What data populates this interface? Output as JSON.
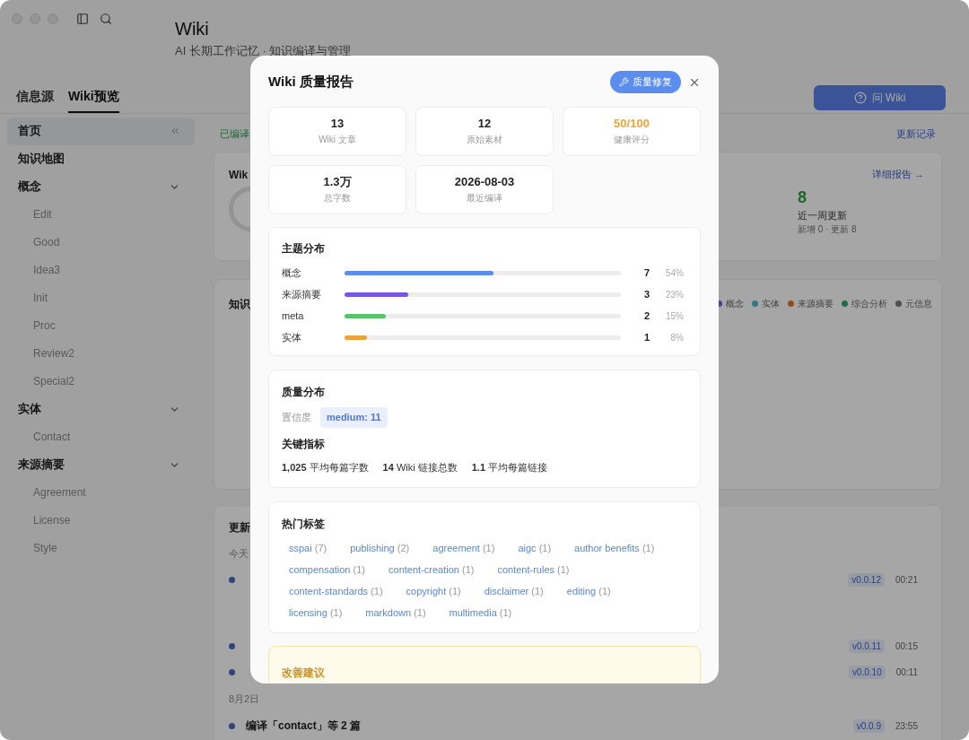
{
  "window": {
    "title": "Wiki",
    "subtitle": "AI 长期工作记忆 · 知识编译与管理"
  },
  "tabs": [
    {
      "label": "信息源",
      "selected": false
    },
    {
      "label": "Wiki预览",
      "selected": true
    }
  ],
  "ask_button": {
    "label": "问 Wiki"
  },
  "sidebar": {
    "items": [
      {
        "label": "首页",
        "selected": true
      },
      {
        "label": "知识地图",
        "selected": false
      },
      {
        "label": "概念",
        "selected": false,
        "expanded": true,
        "children": [
          {
            "label": "Edit",
            "selected": false
          },
          {
            "label": "Good",
            "selected": false
          },
          {
            "label": "Idea3",
            "selected": false
          },
          {
            "label": "Init",
            "selected": false
          },
          {
            "label": "Proc",
            "selected": false
          },
          {
            "label": "Review2",
            "selected": false
          },
          {
            "label": "Special2",
            "selected": false
          }
        ]
      },
      {
        "label": "实体",
        "selected": false,
        "expanded": true,
        "children": [
          {
            "label": "Contact",
            "selected": false
          }
        ]
      },
      {
        "label": "来源摘要",
        "selected": false,
        "expanded": true,
        "children": [
          {
            "label": "Agreement",
            "selected": false
          },
          {
            "label": "License",
            "selected": false
          },
          {
            "label": "Style",
            "selected": false
          }
        ]
      }
    ]
  },
  "main": {
    "status": "已编译",
    "history_link": "更新记录",
    "overview_card": {
      "title": "Wik",
      "detail_link": "详细报告 →",
      "stat_value": "8",
      "stat_label": "近一周更新",
      "stat_note": "新增 0 · 更新 8"
    },
    "map_card": {
      "title": "知识",
      "legend": [
        {
          "label": "概念",
          "color": "#40429d"
        },
        {
          "label": "实体",
          "color": "#337887"
        },
        {
          "label": "来源摘要",
          "color": "#934d1b"
        },
        {
          "label": "综合分析",
          "color": "#1f6b48"
        },
        {
          "label": "元信息",
          "color": "#4f4f4f"
        }
      ]
    },
    "updates_card": {
      "title": "更新",
      "groups": [
        {
          "date": "今天",
          "items": [
            {
              "version": "v0.0.12",
              "time": "00:21"
            },
            {
              "version": "v0.0.11",
              "time": "00:15"
            },
            {
              "version": "v0.0.10",
              "time": "00:11"
            }
          ]
        },
        {
          "date": "8月2日",
          "items": [
            {
              "title": "编译「contact」等 2 篇",
              "version": "v0.0.9",
              "time": "23:55"
            }
          ]
        }
      ]
    }
  },
  "modal": {
    "title": "Wiki 质量报告",
    "fix_button": "质量修复",
    "stats": [
      {
        "value": "13",
        "label": "Wiki 文章",
        "kind": "plain"
      },
      {
        "value": "12",
        "label": "原始素材",
        "kind": "plain"
      },
      {
        "value": "50/100",
        "label": "健康评分",
        "kind": "score"
      },
      {
        "value": "1.3万",
        "label": "总字数",
        "kind": "plain"
      },
      {
        "value": "2026-08-03",
        "label": "最近编译",
        "kind": "plain"
      }
    ],
    "topics": {
      "title": "主题分布",
      "rows": [
        {
          "label": "概念",
          "count": "7",
          "percent": "54%",
          "level": 0.54,
          "color": "#5b8def"
        },
        {
          "label": "来源摘要",
          "count": "3",
          "percent": "23%",
          "level": 0.23,
          "color": "#7456e8"
        },
        {
          "label": "meta",
          "count": "2",
          "percent": "15%",
          "level": 0.15,
          "color": "#5cc26a"
        },
        {
          "label": "实体",
          "count": "1",
          "percent": "8%",
          "level": 0.08,
          "color": "#eba43a"
        }
      ]
    },
    "quality": {
      "title": "质量分布",
      "confidence_label": "置信度",
      "confidence_badges": [
        "medium: 11"
      ],
      "metrics_title": "关键指标",
      "metrics": [
        "**1,025** 平均每篇字数",
        "**14** Wiki 链接总数",
        "**1.1** 平均每篇链接"
      ]
    },
    "tags": {
      "title": "热门标签",
      "items": [
        {
          "name": "sspai",
          "count": "(7)"
        },
        {
          "name": "publishing",
          "count": "(2)"
        },
        {
          "name": "agreement",
          "count": "(1)"
        },
        {
          "name": "aigc",
          "count": "(1)"
        },
        {
          "name": "author benefits",
          "count": "(1)"
        },
        {
          "name": "compensation",
          "count": "(1)"
        },
        {
          "name": "content-creation",
          "count": "(1)"
        },
        {
          "name": "content-rules",
          "count": "(1)"
        },
        {
          "name": "content-standards",
          "count": "(1)"
        },
        {
          "name": "copyright",
          "count": "(1)"
        },
        {
          "name": "disclaimer",
          "count": "(1)"
        },
        {
          "name": "editing",
          "count": "(1)"
        },
        {
          "name": "licensing",
          "count": "(1)"
        },
        {
          "name": "markdown",
          "count": "(1)"
        },
        {
          "name": "multimedia",
          "count": "(1)"
        }
      ]
    },
    "suggestions": {
      "title": "改善建议"
    }
  }
}
